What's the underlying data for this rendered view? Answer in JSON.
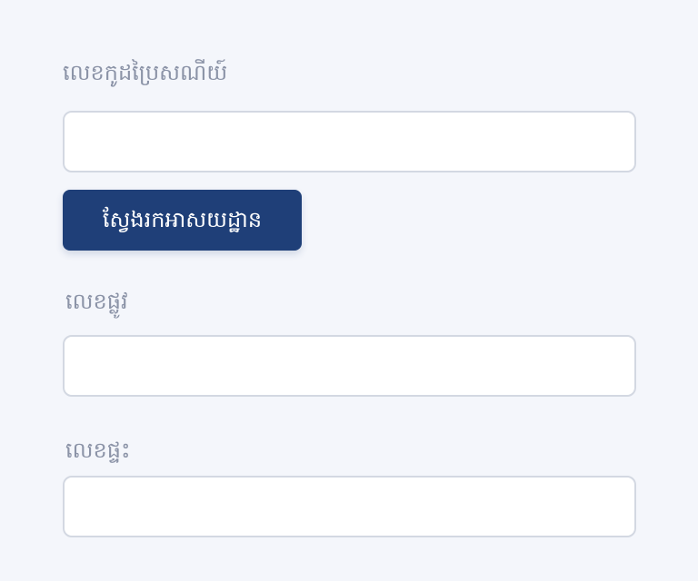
{
  "form": {
    "postal_code": {
      "label": "លេខកូដប្រៃសណីយ៍",
      "value": "",
      "placeholder": ""
    },
    "find_address_button": {
      "label": "ស្វែងរកអាសយដ្ឋាន"
    },
    "street_number": {
      "label": "លេខផ្លូវ",
      "value": "",
      "placeholder": ""
    },
    "house_number": {
      "label": "លេខផ្ទះ",
      "value": "",
      "placeholder": ""
    }
  },
  "colors": {
    "background": "#f4f6fb",
    "label_text": "#8b93a7",
    "input_border": "#d3d8e2",
    "input_background": "#ffffff",
    "button_background": "#1f3f78",
    "button_text": "#ffffff"
  }
}
